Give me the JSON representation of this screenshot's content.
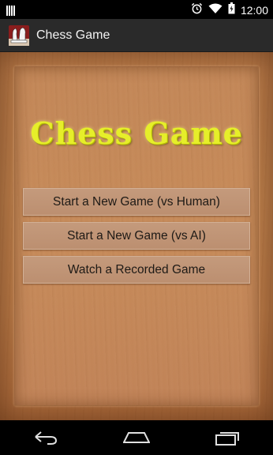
{
  "status_bar": {
    "time": "12:00",
    "icons": [
      "notification-icon",
      "alarm-icon",
      "wifi-icon",
      "battery-icon"
    ]
  },
  "action_bar": {
    "title": "Chess Game",
    "icon": "chess-app-icon"
  },
  "main": {
    "heading": "Chess Game",
    "buttons": [
      {
        "label": "Start a New Game (vs Human)"
      },
      {
        "label": "Start a New Game (vs AI)"
      },
      {
        "label": "Watch a Recorded Game"
      }
    ]
  },
  "nav_bar": {
    "icons": [
      "back-icon",
      "home-icon",
      "recent-apps-icon"
    ]
  },
  "colors": {
    "title_yellow": "#e6ee2a",
    "wood": "#c0834f",
    "button": "#c49a7c"
  }
}
